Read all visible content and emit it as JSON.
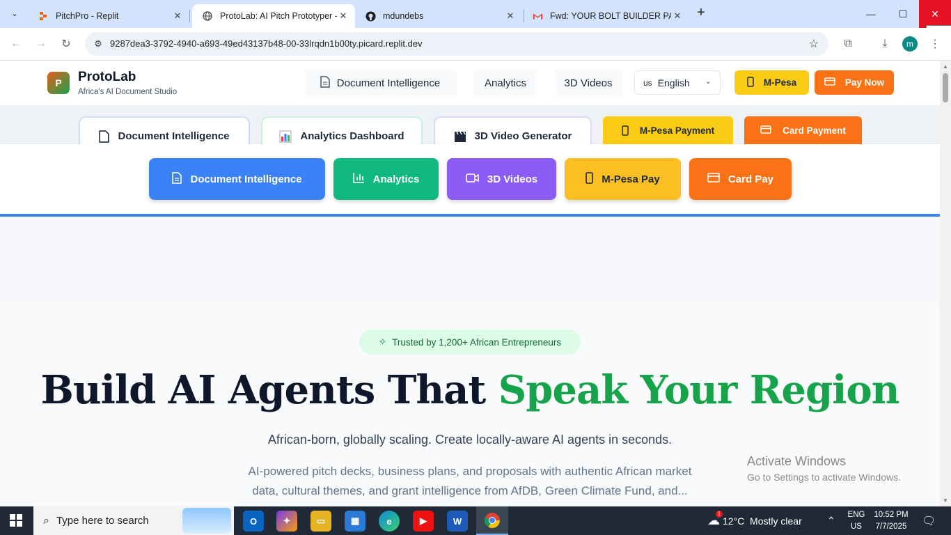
{
  "browser": {
    "tabs": [
      {
        "title": "PitchPro - Replit",
        "favicon": "replit-icon"
      },
      {
        "title": "ProtoLab: AI Pitch Prototyper - C",
        "favicon": "globe-icon"
      },
      {
        "title": "mdundebs",
        "favicon": "github-icon"
      },
      {
        "title": "Fwd: YOUR BOLT BUILDER PACK",
        "favicon": "gmail-icon"
      }
    ],
    "url": "9287dea3-3792-4940-a693-49ed43137b48-00-33lrqdn1b00ty.picard.replit.dev",
    "profile_initial": "m",
    "close_tooltip": "Close"
  },
  "header": {
    "logo_letter": "P",
    "brand": "ProtoLab",
    "tagline": "Africa's AI Document Studio",
    "nav": [
      "Document Intelligence",
      "Analytics",
      "3D Videos"
    ],
    "language": {
      "flag": "us",
      "value": "English"
    },
    "mpesa_label": "M-Pesa",
    "paynow_label": "Pay Now"
  },
  "tabs_row": {
    "doc": "Document Intelligence",
    "analytics": "Analytics Dashboard",
    "video": "3D Video Generator",
    "mpesa": "M-Pesa Payment",
    "card": "Card Payment"
  },
  "actions": {
    "doc": "Document Intelligence",
    "analytics": "Analytics",
    "videos": "3D Videos",
    "mpesa": "M-Pesa Pay",
    "card": "Card Pay"
  },
  "hero": {
    "badge": "Trusted by 1,200+ African Entrepreneurs",
    "headline_dark": "Build AI Agents That ",
    "headline_green": "Speak Your Region",
    "subtitle": "African-born, globally scaling. Create locally-aware AI agents in seconds.",
    "description": "AI-powered pitch decks, business plans, and proposals with authentic African market data, cultural themes, and grant intelligence from AfDB, Green Climate Fund, and..."
  },
  "watermark": {
    "line1": "Activate Windows",
    "line2": "Go to Settings to activate Windows."
  },
  "taskbar": {
    "search_placeholder": "Type here to search",
    "weather": "12°C  Mostly clear",
    "weather_badge": "1",
    "lang1": "ENG",
    "lang2": "US",
    "time": "10:52 PM",
    "date": "7/7/2025"
  },
  "colors": {
    "blue": "#3b82f6",
    "green": "#10b981",
    "purple": "#8b5cf6",
    "yellow": "#fbbf24",
    "orange": "#f97316",
    "headline_green": "#16a34a"
  }
}
